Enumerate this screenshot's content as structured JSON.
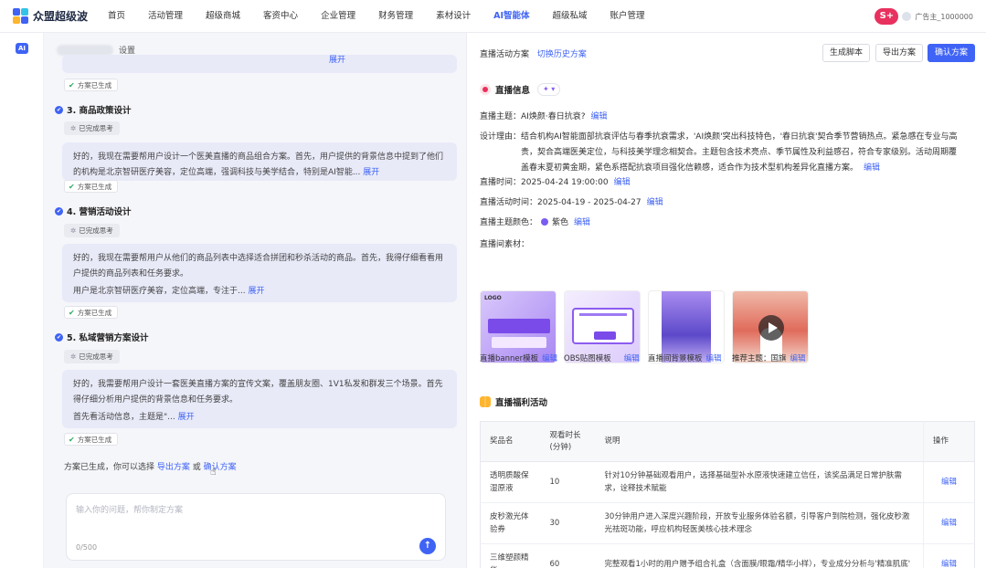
{
  "brand": {
    "name": "众盟超级波"
  },
  "nav": {
    "items": [
      "首页",
      "活动管理",
      "超级商城",
      "客资中心",
      "企业管理",
      "财务管理",
      "素材设计",
      "AI智能体",
      "超级私域",
      "账户管理"
    ],
    "active_index": 7
  },
  "user": {
    "badge": "S+",
    "name": "广告主_1000000"
  },
  "rail": {
    "ai_label": "AI"
  },
  "chat": {
    "header_suffix": "设置",
    "gen_label": "方案已生成",
    "bubble0_more": "展开",
    "steps": [
      {
        "index": "3",
        "title": "3. 商品政策设计",
        "think": "已完成思考",
        "text1": "好的，我现在需要帮用户设计一个医美直播的商品组合方案。首先，用户提供的背景信息中提到了他们的机构是北京智研医疗美容，定位高端，强调科技与美学结合，特别是AI智能...",
        "more": "展开"
      },
      {
        "index": "4",
        "title": "4. 营销活动设计",
        "think": "已完成思考",
        "text1": "好的，我现在需要帮用户从他们的商品列表中选择适合拼团和秒杀活动的商品。首先，我得仔细看看用户提供的商品列表和任务要求。",
        "text2": "用户是北京智研医疗美容，定位高端，专注于...",
        "more": "展开"
      },
      {
        "index": "5",
        "title": "5. 私域营销方案设计",
        "think": "已完成思考",
        "text1": "好的，我需要帮用户设计一套医美直播方案的宣传文案，覆盖朋友圈、1V1私发和群发三个场景。首先得仔细分析用户提供的背景信息和任务要求。",
        "text2": "首先看活动信息，主题是\"...",
        "more": "展开"
      }
    ],
    "done_text": "方案已生成，你可以选择",
    "done_link1": "导出方案",
    "done_or": "或",
    "done_link2": "确认方案",
    "input_placeholder": "输入你的问题，帮你制定方案",
    "char_count": "0/500"
  },
  "detail": {
    "top_label": "直播活动方案",
    "top_link": "切换历史方案",
    "buttons": {
      "gen": "生成脚本",
      "export": "导出方案",
      "confirm": "确认方案"
    },
    "section1": "直播信息",
    "ai_chip": "✦ ▾",
    "edit": "编辑",
    "theme_label": "直播主题：",
    "theme_value": "AI焕颜·春日抗衰?",
    "reason_label": "设计理由：",
    "reason_value": "结合机构AI智能面部抗衰评估与春季抗衰需求，'AI焕颜'突出科技特色，'春日抗衰'契合季节营销热点。紧急感在专业与高贵，契合高端医美定位，与科技美学理念相契合。主题包含技术亮点、季节属性及利益感召，符合专家级别。活动周期覆盖春末夏初黄金期，紧色系搭配抗衰项目强化信赖感，适合作为技术型机构差异化直播方案。",
    "time_label": "直播时间：",
    "time_value": "2025-04-24 19:00:00",
    "period_label": "直播活动时间：",
    "period_value": "2025-04-19 - 2025-04-27",
    "color_label": "直播主题颜色：",
    "color_value": "紫色",
    "imgs_label": "直播间素材：",
    "img_logo": "LOGO",
    "captions": [
      "直播banner模板",
      "OBS贴图模板",
      "直播间背景模板",
      "推荐主题：国旗"
    ],
    "section2": "直播福利活动",
    "table": {
      "headers": [
        "奖品名",
        "观看时长\n(分钟)",
        "说明",
        "操作"
      ],
      "rows": [
        {
          "name": "透明质酸保湿原液",
          "minutes": "10",
          "desc": "针对10分钟基础观看用户，选择基础型补水原液快速建立信任，该奖品满足日常护肤需求，诠释技术赋能",
          "op": "编辑"
        },
        {
          "name": "皮秒激光体验券",
          "minutes": "30",
          "desc": "30分钟用户进入深度兴趣阶段，开放专业服务体验名额，引导客户到院检测，强化皮秒激光祛斑功能，呼应机构轻医美核心技术理念",
          "op": "编辑"
        },
        {
          "name": "三维塑颜精华",
          "minutes": "60",
          "desc": "完整观看1小时的用户赠予组合礼盒（含面膜/眼霜/精华小样），专业成分分析与'精准肌底'",
          "op": "编辑"
        }
      ]
    }
  }
}
